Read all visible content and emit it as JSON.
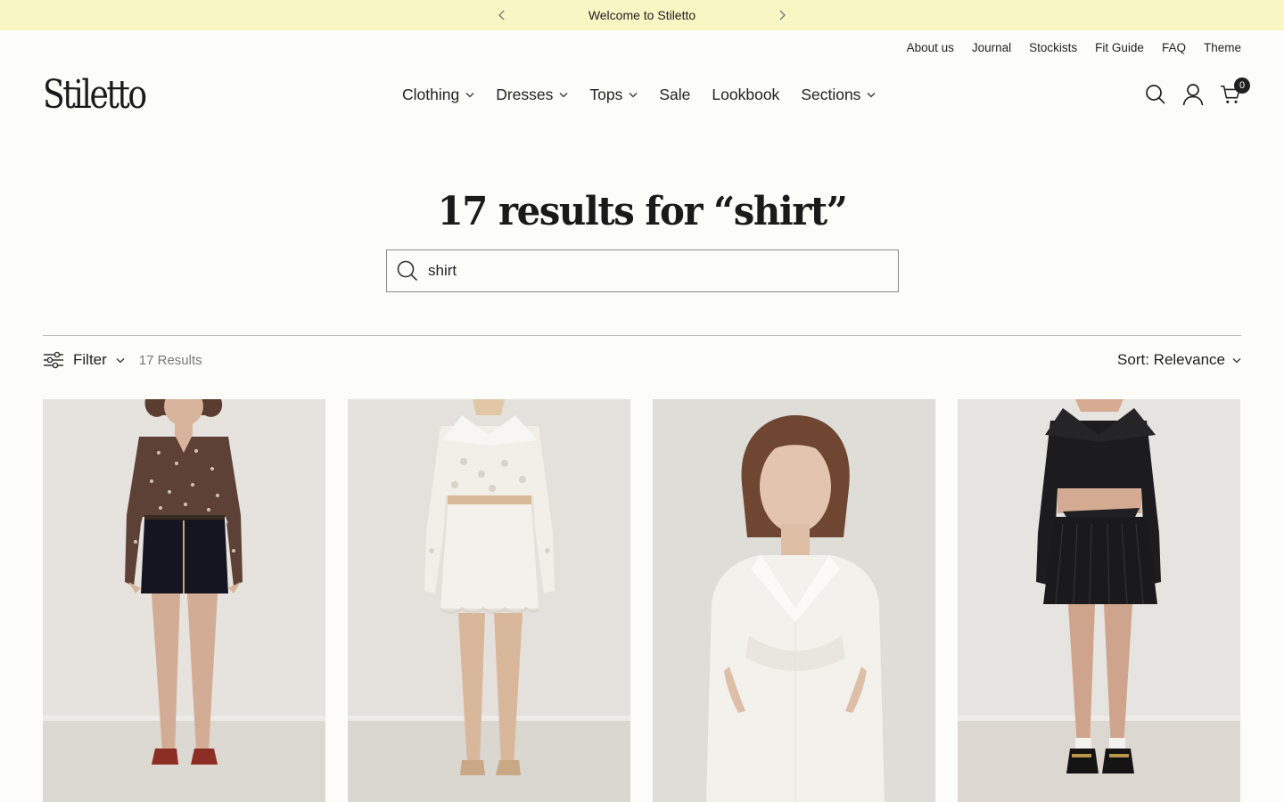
{
  "announcement": {
    "message": "Welcome to Stiletto"
  },
  "utility_nav": [
    {
      "label": "About us"
    },
    {
      "label": "Journal"
    },
    {
      "label": "Stockists"
    },
    {
      "label": "Fit Guide"
    },
    {
      "label": "FAQ"
    },
    {
      "label": "Theme"
    }
  ],
  "header": {
    "logo": "Stiletto",
    "nav": [
      {
        "label": "Clothing",
        "has_dropdown": true
      },
      {
        "label": "Dresses",
        "has_dropdown": true
      },
      {
        "label": "Tops",
        "has_dropdown": true
      },
      {
        "label": "Sale",
        "has_dropdown": false
      },
      {
        "label": "Lookbook",
        "has_dropdown": false
      },
      {
        "label": "Sections",
        "has_dropdown": true
      }
    ],
    "cart_count": "0",
    "icons": [
      "search-icon",
      "account-icon",
      "cart-icon"
    ]
  },
  "search": {
    "title": "17 results for “shirt”",
    "query": "shirt"
  },
  "toolbar": {
    "filter_label": "Filter",
    "result_count": "17 Results",
    "sort_label": "Sort: Relevance"
  },
  "products": [
    {
      "image": "model-in-brown-polka-dot-blouse-black-mini-skirt"
    },
    {
      "image": "model-in-white-eyelet-cropped-shirt-and-skirt"
    },
    {
      "image": "model-in-white-shirt-dress-with-cutouts"
    },
    {
      "image": "model-in-black-cropped-shirt-pleated-skirt"
    }
  ],
  "colors": {
    "announcement_bg": "#f8f6c2",
    "page_bg": "#fcfcf8",
    "text": "#1f1f1f"
  }
}
